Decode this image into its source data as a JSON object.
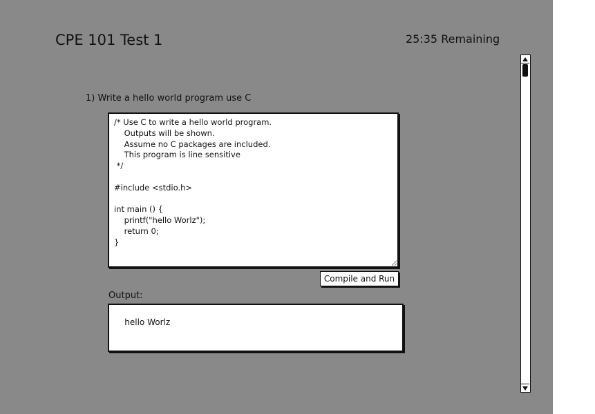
{
  "header": {
    "title": "CPE 101 Test 1",
    "timer": "25:35 Remaining"
  },
  "question": {
    "text": "1) Write a hello world program use C"
  },
  "editor": {
    "code": "/* Use C to write a hello world program.\n    Outputs will be shown.\n    Assume no C packages are included.\n    This program is line sensitive\n */\n\n#include <stdio.h>\n\nint main () {\n    printf(\"hello Worlz\");\n    return 0;\n}"
  },
  "toolbar": {
    "run_label": "Compile and Run"
  },
  "output": {
    "label": "Output:",
    "text": "hello Worlz"
  },
  "scrollbar": {
    "up_icon": "scroll-up-arrow",
    "down_icon": "scroll-down-arrow"
  },
  "colors": {
    "background": "#898989",
    "panel": "#ffffff",
    "ink": "#111111"
  }
}
